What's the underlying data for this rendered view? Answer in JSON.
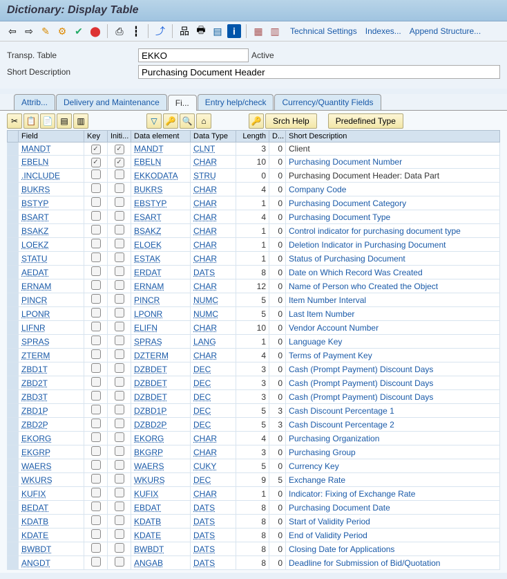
{
  "title": "Dictionary: Display Table",
  "toolbar_links": {
    "tech": "Technical Settings",
    "indexes": "Indexes...",
    "append": "Append Structure..."
  },
  "info": {
    "table_label": "Transp. Table",
    "table_value": "EKKO",
    "status": "Active",
    "desc_label": "Short Description",
    "desc_value": "Purchasing Document Header"
  },
  "tabs": [
    "Attrib...",
    "Delivery and Maintenance",
    "Fi...",
    "Entry help/check",
    "Currency/Quantity Fields"
  ],
  "buttons": {
    "srch": "Srch Help",
    "pre": "Predefined Type"
  },
  "columns": [
    "Field",
    "Key",
    "Initi...",
    "Data element",
    "Data Type",
    "Length",
    "D...",
    "Short Description"
  ],
  "rows": [
    {
      "field": "MANDT",
      "key": true,
      "init": true,
      "de": "MANDT",
      "dt": "CLNT",
      "len": 3,
      "d": 0,
      "desc": "Client",
      "link": false
    },
    {
      "field": "EBELN",
      "key": true,
      "init": true,
      "de": "EBELN",
      "dt": "CHAR",
      "len": 10,
      "d": 0,
      "desc": "Purchasing Document Number",
      "link": true
    },
    {
      "field": ".INCLUDE",
      "key": false,
      "init": false,
      "de": "EKKODATA",
      "dt": "STRU",
      "len": 0,
      "d": 0,
      "desc": "Purchasing Document Header: Data Part",
      "link": false
    },
    {
      "field": "BUKRS",
      "key": false,
      "init": false,
      "de": "BUKRS",
      "dt": "CHAR",
      "len": 4,
      "d": 0,
      "desc": "Company Code",
      "link": true
    },
    {
      "field": "BSTYP",
      "key": false,
      "init": false,
      "de": "EBSTYP",
      "dt": "CHAR",
      "len": 1,
      "d": 0,
      "desc": "Purchasing Document Category",
      "link": true
    },
    {
      "field": "BSART",
      "key": false,
      "init": false,
      "de": "ESART",
      "dt": "CHAR",
      "len": 4,
      "d": 0,
      "desc": "Purchasing Document Type",
      "link": true
    },
    {
      "field": "BSAKZ",
      "key": false,
      "init": false,
      "de": "BSAKZ",
      "dt": "CHAR",
      "len": 1,
      "d": 0,
      "desc": "Control indicator for purchasing document type",
      "link": true
    },
    {
      "field": "LOEKZ",
      "key": false,
      "init": false,
      "de": "ELOEK",
      "dt": "CHAR",
      "len": 1,
      "d": 0,
      "desc": "Deletion Indicator in Purchasing Document",
      "link": true
    },
    {
      "field": "STATU",
      "key": false,
      "init": false,
      "de": "ESTAK",
      "dt": "CHAR",
      "len": 1,
      "d": 0,
      "desc": "Status of Purchasing Document",
      "link": true
    },
    {
      "field": "AEDAT",
      "key": false,
      "init": false,
      "de": "ERDAT",
      "dt": "DATS",
      "len": 8,
      "d": 0,
      "desc": "Date on Which Record Was Created",
      "link": true
    },
    {
      "field": "ERNAM",
      "key": false,
      "init": false,
      "de": "ERNAM",
      "dt": "CHAR",
      "len": 12,
      "d": 0,
      "desc": "Name of Person who Created the Object",
      "link": true
    },
    {
      "field": "PINCR",
      "key": false,
      "init": false,
      "de": "PINCR",
      "dt": "NUMC",
      "len": 5,
      "d": 0,
      "desc": "Item Number Interval",
      "link": true
    },
    {
      "field": "LPONR",
      "key": false,
      "init": false,
      "de": "LPONR",
      "dt": "NUMC",
      "len": 5,
      "d": 0,
      "desc": "Last Item Number",
      "link": true
    },
    {
      "field": "LIFNR",
      "key": false,
      "init": false,
      "de": "ELIFN",
      "dt": "CHAR",
      "len": 10,
      "d": 0,
      "desc": "Vendor Account Number",
      "link": true
    },
    {
      "field": "SPRAS",
      "key": false,
      "init": false,
      "de": "SPRAS",
      "dt": "LANG",
      "len": 1,
      "d": 0,
      "desc": "Language Key",
      "link": true
    },
    {
      "field": "ZTERM",
      "key": false,
      "init": false,
      "de": "DZTERM",
      "dt": "CHAR",
      "len": 4,
      "d": 0,
      "desc": "Terms of Payment Key",
      "link": true
    },
    {
      "field": "ZBD1T",
      "key": false,
      "init": false,
      "de": "DZBDET",
      "dt": "DEC",
      "len": 3,
      "d": 0,
      "desc": "Cash (Prompt Payment) Discount Days",
      "link": true
    },
    {
      "field": "ZBD2T",
      "key": false,
      "init": false,
      "de": "DZBDET",
      "dt": "DEC",
      "len": 3,
      "d": 0,
      "desc": "Cash (Prompt Payment) Discount Days",
      "link": true
    },
    {
      "field": "ZBD3T",
      "key": false,
      "init": false,
      "de": "DZBDET",
      "dt": "DEC",
      "len": 3,
      "d": 0,
      "desc": "Cash (Prompt Payment) Discount Days",
      "link": true
    },
    {
      "field": "ZBD1P",
      "key": false,
      "init": false,
      "de": "DZBD1P",
      "dt": "DEC",
      "len": 5,
      "d": 3,
      "desc": "Cash Discount Percentage 1",
      "link": true
    },
    {
      "field": "ZBD2P",
      "key": false,
      "init": false,
      "de": "DZBD2P",
      "dt": "DEC",
      "len": 5,
      "d": 3,
      "desc": "Cash Discount Percentage 2",
      "link": true
    },
    {
      "field": "EKORG",
      "key": false,
      "init": false,
      "de": "EKORG",
      "dt": "CHAR",
      "len": 4,
      "d": 0,
      "desc": "Purchasing Organization",
      "link": true
    },
    {
      "field": "EKGRP",
      "key": false,
      "init": false,
      "de": "BKGRP",
      "dt": "CHAR",
      "len": 3,
      "d": 0,
      "desc": "Purchasing Group",
      "link": true
    },
    {
      "field": "WAERS",
      "key": false,
      "init": false,
      "de": "WAERS",
      "dt": "CUKY",
      "len": 5,
      "d": 0,
      "desc": "Currency Key",
      "link": true
    },
    {
      "field": "WKURS",
      "key": false,
      "init": false,
      "de": "WKURS",
      "dt": "DEC",
      "len": 9,
      "d": 5,
      "desc": "Exchange Rate",
      "link": true
    },
    {
      "field": "KUFIX",
      "key": false,
      "init": false,
      "de": "KUFIX",
      "dt": "CHAR",
      "len": 1,
      "d": 0,
      "desc": "Indicator: Fixing of Exchange Rate",
      "link": true
    },
    {
      "field": "BEDAT",
      "key": false,
      "init": false,
      "de": "EBDAT",
      "dt": "DATS",
      "len": 8,
      "d": 0,
      "desc": "Purchasing Document Date",
      "link": true
    },
    {
      "field": "KDATB",
      "key": false,
      "init": false,
      "de": "KDATB",
      "dt": "DATS",
      "len": 8,
      "d": 0,
      "desc": "Start of Validity Period",
      "link": true
    },
    {
      "field": "KDATE",
      "key": false,
      "init": false,
      "de": "KDATE",
      "dt": "DATS",
      "len": 8,
      "d": 0,
      "desc": "End of Validity Period",
      "link": true
    },
    {
      "field": "BWBDT",
      "key": false,
      "init": false,
      "de": "BWBDT",
      "dt": "DATS",
      "len": 8,
      "d": 0,
      "desc": "Closing Date for Applications",
      "link": true
    },
    {
      "field": "ANGDT",
      "key": false,
      "init": false,
      "de": "ANGAB",
      "dt": "DATS",
      "len": 8,
      "d": 0,
      "desc": "Deadline for Submission of Bid/Quotation",
      "link": true
    }
  ]
}
